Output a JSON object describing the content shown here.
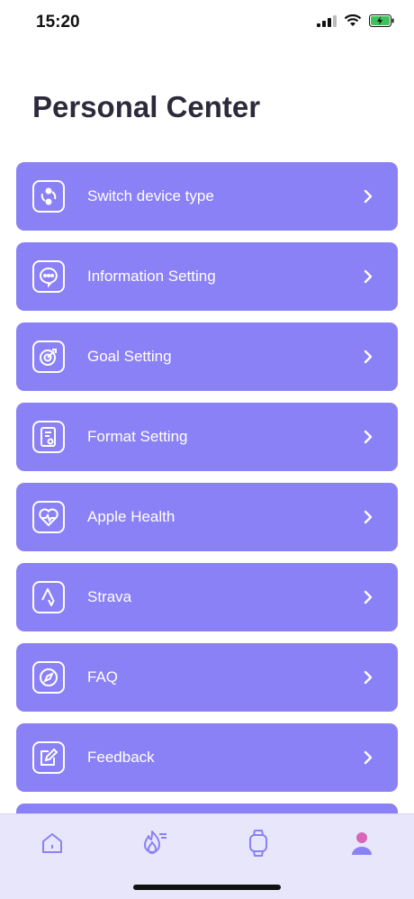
{
  "status_bar": {
    "time": "15:20"
  },
  "page": {
    "title": "Personal Center"
  },
  "menu": {
    "items": [
      {
        "label": "Switch device type",
        "icon": "switch-device-icon"
      },
      {
        "label": "Information Setting",
        "icon": "chat-bubble-icon"
      },
      {
        "label": "Goal Setting",
        "icon": "target-icon"
      },
      {
        "label": "Format Setting",
        "icon": "document-gear-icon"
      },
      {
        "label": "Apple Health",
        "icon": "heart-pulse-icon"
      },
      {
        "label": "Strava",
        "icon": "strava-icon"
      },
      {
        "label": "FAQ",
        "icon": "compass-icon"
      },
      {
        "label": "Feedback",
        "icon": "edit-note-icon"
      }
    ]
  },
  "tab_bar": {
    "tabs": [
      {
        "icon": "home-icon",
        "active": false
      },
      {
        "icon": "flame-icon",
        "active": false
      },
      {
        "icon": "watch-icon",
        "active": false
      },
      {
        "icon": "profile-icon",
        "active": true
      }
    ]
  },
  "colors": {
    "menu_background": "#8b81f6",
    "tab_bar_background": "#e8e6fb",
    "tab_icon_inactive": "#8b81f6",
    "tab_icon_active": "#d667b8",
    "title": "#2d2b3b"
  }
}
